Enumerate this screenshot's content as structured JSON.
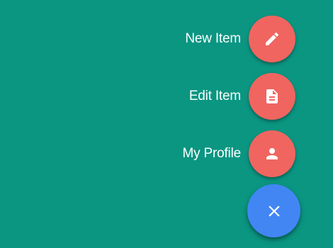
{
  "colors": {
    "background": "#0b9682",
    "action_button": "#f06560",
    "main_button": "#4286f4",
    "icon": "#ffffff",
    "label": "#ffffff"
  },
  "menu": {
    "items": [
      {
        "label": "New Item",
        "icon": "pencil-icon"
      },
      {
        "label": "Edit Item",
        "icon": "document-icon"
      },
      {
        "label": "My Profile",
        "icon": "person-icon"
      }
    ]
  },
  "main_button": {
    "icon": "close-icon",
    "state": "open"
  }
}
